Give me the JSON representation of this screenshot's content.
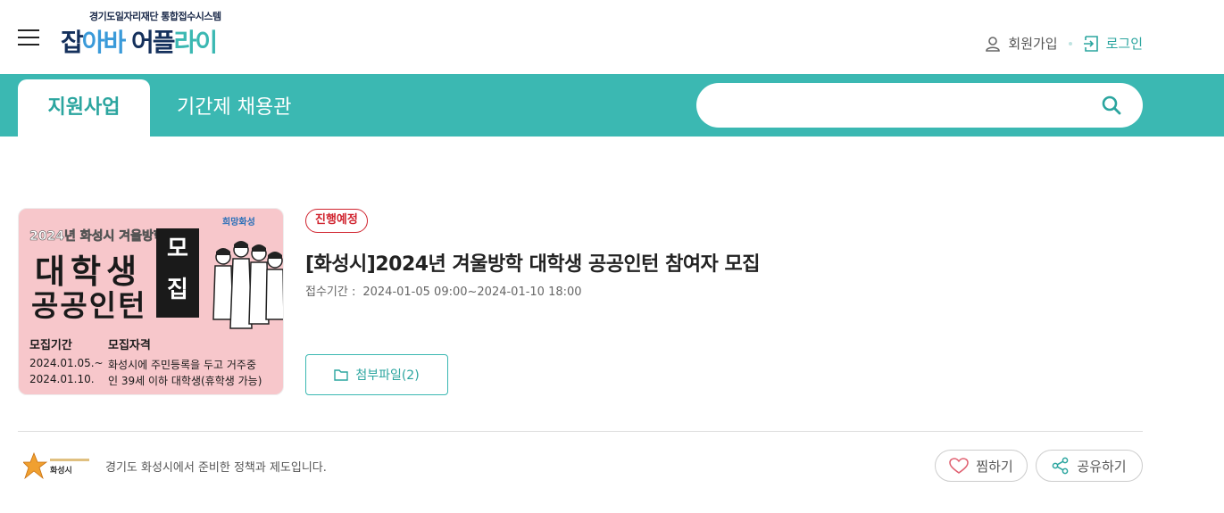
{
  "header": {
    "logo_sub": "경기도일자리재단 통합접수시스템",
    "logo_parts": [
      "잡",
      "아바 ",
      "어플",
      "라이"
    ],
    "join_label": "회원가입",
    "login_label": "로그인"
  },
  "nav": {
    "tabs": [
      {
        "label": "지원사업",
        "active": true
      },
      {
        "label": "기간제 채용관",
        "active": false
      }
    ],
    "search_placeholder": ""
  },
  "post": {
    "status": "진행예정",
    "title": "[화성시]2024년 겨울방학 대학생 공공인턴 참여자 모집",
    "period_label": "접수기간 :",
    "period_value": "2024-01-05 09:00~2024-01-10 18:00",
    "attach_label": "첨부파일(2)",
    "thumbnail": {
      "line1": "2024년 화성시 겨울방학",
      "line2": "대학생",
      "line3": "공공인턴",
      "mojip": [
        "모",
        "집"
      ],
      "logo": "희망화성",
      "label_period": "모집기간",
      "label_qual": "모집자격",
      "date1": "2024.01.05.~",
      "date2": "2024.01.10.",
      "qual1": "화성시에 주민등록을 두고 거주중",
      "qual2": "인 39세 이하 대학생(휴학생 가능)"
    }
  },
  "footer": {
    "org_logo_text": "화성시",
    "org_description": "경기도 화성시에서 준비한 정책과 제도입니다.",
    "like_label": "찜하기",
    "share_label": "공유하기"
  },
  "colors": {
    "teal": "#3bb8b2",
    "teal_dark": "#2ba59f",
    "badge_red": "#d0242f",
    "navy": "#14305c"
  }
}
